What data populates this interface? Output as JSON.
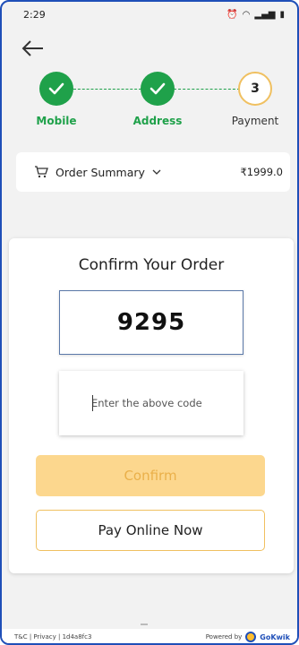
{
  "status_bar": {
    "time": "2:29"
  },
  "stepper": {
    "steps": [
      {
        "label": "Mobile",
        "state": "done"
      },
      {
        "label": "Address",
        "state": "done"
      },
      {
        "label": "3",
        "name": "Payment",
        "state": "current"
      }
    ]
  },
  "summary": {
    "label": "Order Summary",
    "amount": "₹1999.0"
  },
  "card": {
    "title": "Confirm Your Order",
    "captcha": "9295",
    "code_placeholder": "Enter the above code",
    "confirm_label": "Confirm",
    "pay_label": "Pay Online Now"
  },
  "footer": {
    "links": "T&C | Privacy | 1d4a8fc3",
    "powered_by": "Powered by",
    "brand": "GoKwik"
  },
  "colors": {
    "accent_green": "#1fa14a",
    "accent_orange": "#f0c060",
    "confirm_bg": "#fcd78e",
    "frame": "#1f4fb8"
  }
}
